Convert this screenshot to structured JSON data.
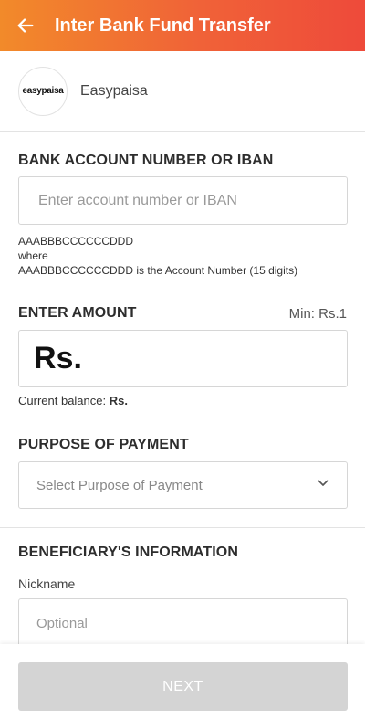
{
  "header": {
    "title": "Inter Bank Fund Transfer"
  },
  "bank": {
    "logo_text": "easypaisa",
    "name": "Easypaisa"
  },
  "account": {
    "label": "BANK ACCOUNT NUMBER OR IBAN",
    "placeholder": "Enter account number or IBAN",
    "hint_line1": "AAABBBCCCCCCDDD",
    "hint_line2": "where",
    "hint_line3": "AAABBBCCCCCCDDD is the Account Number (15 digits)"
  },
  "amount": {
    "label": "ENTER AMOUNT",
    "min_label": "Min: Rs.1",
    "currency": "Rs.",
    "balance_label": "Current balance:",
    "balance_value": "Rs."
  },
  "purpose": {
    "label": "PURPOSE OF PAYMENT",
    "placeholder": "Select Purpose of Payment"
  },
  "beneficiary": {
    "label": "BENEFICIARY'S INFORMATION",
    "nickname_label": "Nickname",
    "nickname_placeholder": "Optional"
  },
  "footer": {
    "next_label": "NEXT"
  }
}
